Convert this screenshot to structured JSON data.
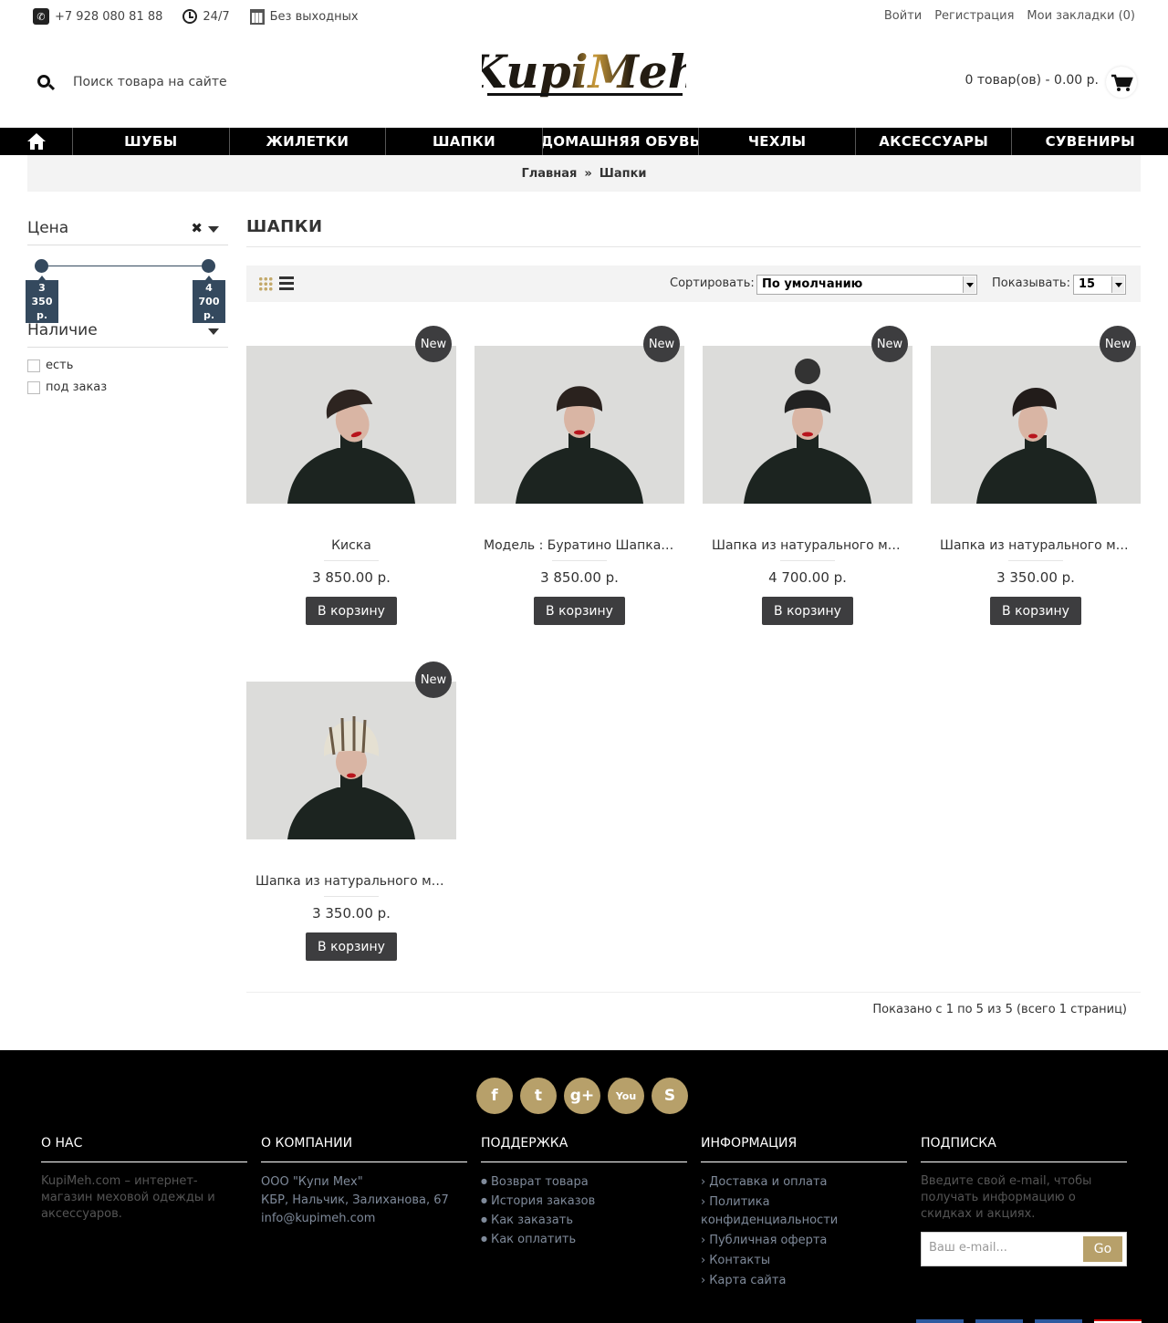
{
  "topbar": {
    "phone": "+7 928 080 81 88",
    "hours": "24/7",
    "days": "Без выходных",
    "login": "Войти",
    "register": "Регистрация",
    "wishlist": "Мои закладки (0)"
  },
  "header": {
    "search_placeholder": "Поиск товара на сайте",
    "logo_text": "KupiMeh",
    "cart": "0 товар(ов) - 0.00 р."
  },
  "nav": [
    "ШУБЫ",
    "ЖИЛЕТКИ",
    "ШАПКИ",
    "ДОМАШНЯЯ ОБУВЬ",
    "ЧЕХЛЫ",
    "АКСЕССУАРЫ",
    "СУВЕНИРЫ"
  ],
  "breadcrumb": {
    "home": "Главная",
    "sep": "»",
    "current": "Шапки"
  },
  "filters": {
    "price_title": "Цена",
    "price_min_label": "3\n350\nр.",
    "price_max_label": "4\n700\nр.",
    "availability_title": "Наличие",
    "opt_in_stock": "есть",
    "opt_on_order": "под заказ"
  },
  "main": {
    "title": "ШАПКИ",
    "sort_label": "Сортировать:",
    "sort_value": "По умолчанию",
    "show_label": "Показывать:",
    "show_value": "15",
    "badge": "New",
    "add_to_cart": "В корзину",
    "products": [
      {
        "name": "Киска",
        "price": "3 850.00 р."
      },
      {
        "name": "Модель : Буратино Шапка из натурального меха",
        "price": "3 850.00 р."
      },
      {
        "name": "Шапка из натурального меха",
        "price": "4 700.00 р."
      },
      {
        "name": "Шапка из натурального меха",
        "price": "3 350.00 р."
      },
      {
        "name": "Шапка из натурального меха",
        "price": "3 350.00 р."
      }
    ],
    "pagination": "Показано с 1 по 5 из 5 (всего 1 страниц)"
  },
  "footer": {
    "socials": [
      "f",
      "t",
      "g+",
      "You",
      "S"
    ],
    "about_title": "О НАС",
    "about_text": "KupiMeh.com  – интернет-магазин меховой одежды и аксессуаров.",
    "company_title": "О КОМПАНИИ",
    "company_lines": [
      "ООО \"Купи Мех\"",
      "КБР, Нальчик, Залиханова, 67",
      "info@kupimeh.com"
    ],
    "support_title": "ПОДДЕРЖКА",
    "support_links": [
      "Возврат товара",
      "История заказов",
      "Как заказать",
      "Как оплатить"
    ],
    "info_title": "ИНФОРМАЦИЯ",
    "info_links": [
      "Доставка и оплата",
      "Политика конфиденциальности",
      "Публичная оферта",
      "Контакты",
      "Карта сайта"
    ],
    "subscribe_title": "ПОДПИСКА",
    "subscribe_text": "Введите свой e-mail, чтобы получать информацию о скидках и акциях.",
    "subscribe_placeholder": "Ваш e-mail...",
    "subscribe_button": "Go"
  },
  "colors": {
    "accent_gold": "#b7a06a",
    "slider": "#34495e",
    "button_dark": "#3d3d3f"
  }
}
